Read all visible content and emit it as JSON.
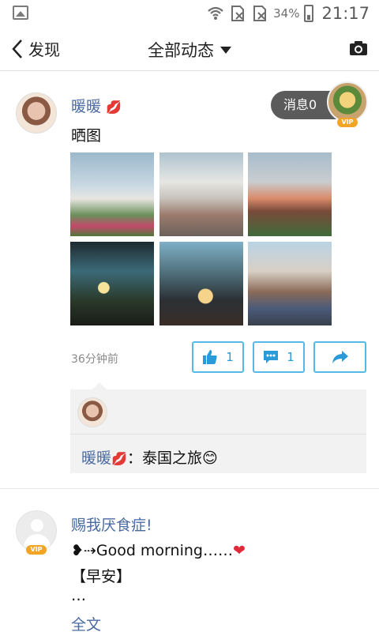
{
  "status_bar": {
    "battery": "34%",
    "time": "21:17"
  },
  "header": {
    "back_label": "发现",
    "title": "全部动态"
  },
  "post1": {
    "username": "暖暖",
    "text": "晒图",
    "time_ago": "36分钟前",
    "like_count": "1",
    "comment_count": "1",
    "reply": {
      "name": "暖暖",
      "text": "：泰国之旅"
    }
  },
  "message_badge": {
    "label": "消息0",
    "vip": "VIP"
  },
  "post2": {
    "username": "赐我厌食症!",
    "vip": "VIP",
    "line1": "Good morning……",
    "line2": "【早安】",
    "line3": "…",
    "full_text_link": "全文"
  },
  "colors": {
    "link_blue": "#4a6aa0",
    "action_blue": "#55b9e6",
    "vip_orange": "#f4a425"
  }
}
